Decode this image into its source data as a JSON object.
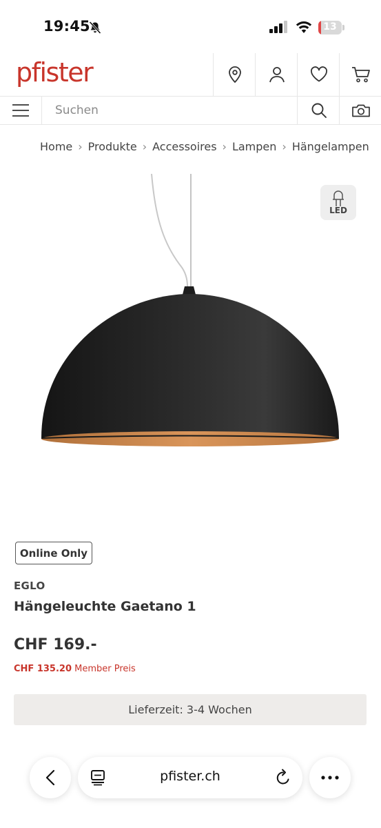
{
  "status_bar": {
    "time": "19:45",
    "battery": "13"
  },
  "header": {
    "logo": "pfister"
  },
  "search": {
    "placeholder": "Suchen"
  },
  "breadcrumb": [
    "Home",
    "Produkte",
    "Accessoires",
    "Lampen",
    "Hängelampen"
  ],
  "product": {
    "badge_led": "LED",
    "online_badge": "Online Only",
    "brand": "EGLO",
    "title": "Hängeleuchte Gaetano 1",
    "price": "CHF 169.-",
    "member_price": "CHF 135.20",
    "member_label": "Member Preis",
    "delivery": "Lieferzeit: 3-4 Wochen"
  },
  "browser": {
    "url": "pfister.ch"
  },
  "colors": {
    "brand": "#c8352b",
    "battery_low": "#e04646"
  }
}
